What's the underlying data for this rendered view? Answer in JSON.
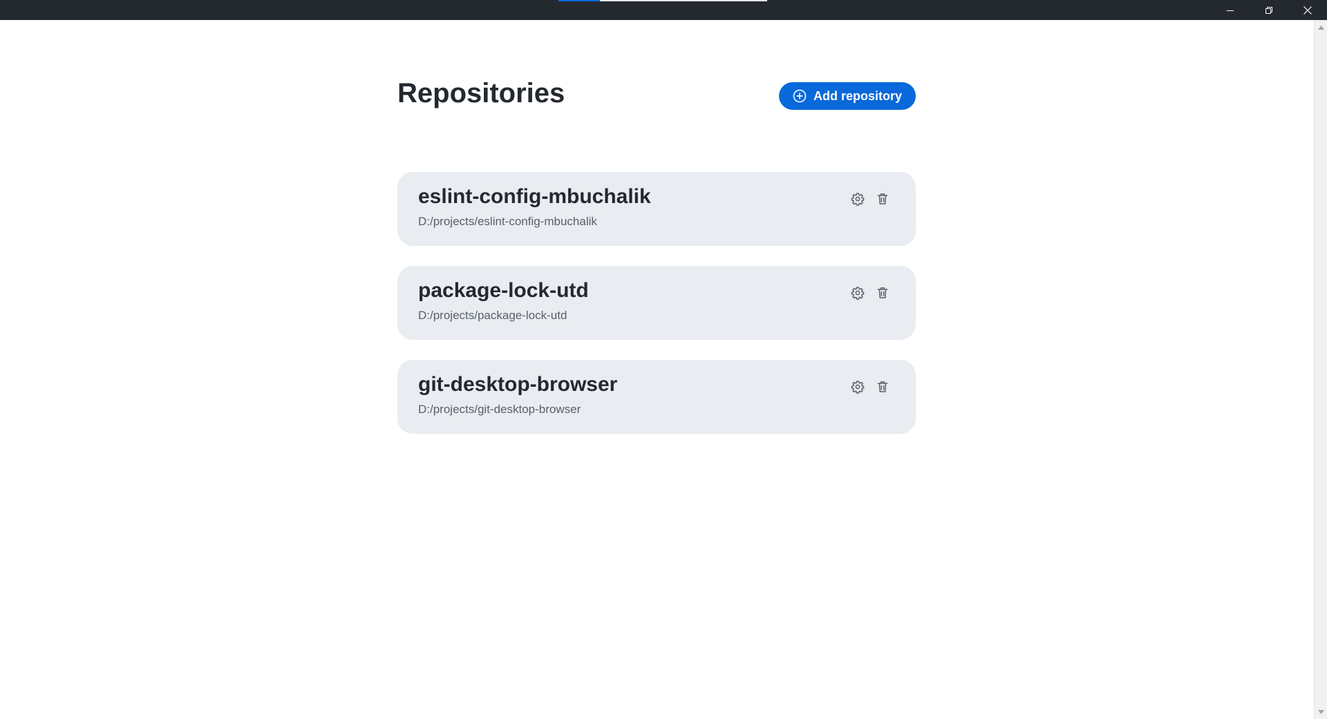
{
  "window": {
    "controls": [
      {
        "name": "minimize",
        "icon": "minimize-icon"
      },
      {
        "name": "restore",
        "icon": "restore-icon"
      },
      {
        "name": "close",
        "icon": "close-icon"
      }
    ]
  },
  "header": {
    "title": "Repositories",
    "add_button_label": "Add repository",
    "add_button_icon": "plus-circle-icon"
  },
  "repositories": [
    {
      "name": "eslint-config-mbuchalik",
      "path": "D:/projects/eslint-config-mbuchalik"
    },
    {
      "name": "package-lock-utd",
      "path": "D:/projects/package-lock-utd"
    },
    {
      "name": "git-desktop-browser",
      "path": "D:/projects/git-desktop-browser"
    }
  ],
  "repo_actions": {
    "settings_icon": "gear-icon",
    "delete_icon": "trash-icon"
  },
  "colors": {
    "accent": "#0969da",
    "titlebar": "#24292f",
    "card_bg": "#e9ecf0",
    "text_primary": "#24292f",
    "text_secondary": "#57606a"
  }
}
